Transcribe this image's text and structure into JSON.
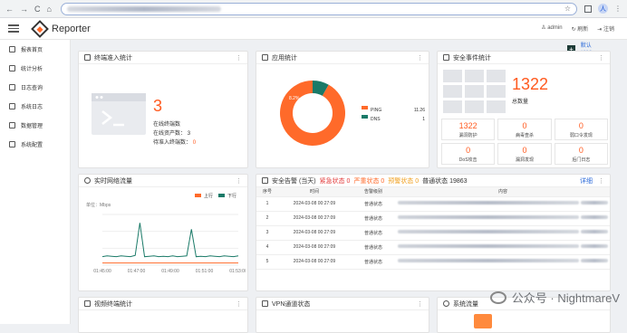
{
  "browser": {
    "back": "←",
    "forward": "→",
    "reload": "C",
    "home": "⌂",
    "star": "☆",
    "menu": "⋮",
    "user_initial": "人"
  },
  "app": {
    "title": "Reporter",
    "user": "admin",
    "refresh": "刷新",
    "logout": "注销",
    "add": "+",
    "default_layout": "默认排版"
  },
  "sidebar": {
    "items": [
      {
        "label": "报表首页",
        "icon": "home-icon"
      },
      {
        "label": "统计分析",
        "icon": "bar-chart-icon"
      },
      {
        "label": "日志查询",
        "icon": "log-icon"
      },
      {
        "label": "系统日志",
        "icon": "file-icon"
      },
      {
        "label": "数据管理",
        "icon": "database-icon"
      },
      {
        "label": "系统配置",
        "icon": "gear-icon"
      }
    ]
  },
  "terminal": {
    "title": "终端准入统计",
    "count": "3",
    "online_label": "在线终端数",
    "online_assets_label": "在线资产数：",
    "online_assets": "3",
    "pending_label": "待准入终端数：",
    "pending": "0"
  },
  "app_stats": {
    "title": "应用统计",
    "legend": [
      {
        "name": "PING",
        "color": "#ff6a2a",
        "value": "11.26"
      },
      {
        "name": "DNS",
        "color": "#1a7a68",
        "value": "1"
      }
    ],
    "chart_data": {
      "type": "pie",
      "slices": [
        {
          "name": "PING",
          "value": 91.8,
          "color": "#ff6a2a"
        },
        {
          "name": "DNS",
          "value": 8.2,
          "color": "#1a7a68"
        }
      ],
      "labels": [
        "8.2%",
        "91.8%"
      ]
    }
  },
  "security": {
    "title": "安全事件统计",
    "total": "1322",
    "total_label": "总数量",
    "cells": [
      {
        "value": "1322",
        "label": "漏洞防护"
      },
      {
        "value": "0",
        "label": "病毒查杀"
      },
      {
        "value": "0",
        "label": "弱口令发现"
      },
      {
        "value": "0",
        "label": "DoS攻击"
      },
      {
        "value": "0",
        "label": "漏洞发现"
      },
      {
        "value": "0",
        "label": "后门日志"
      }
    ]
  },
  "traffic": {
    "title": "实时网络流量",
    "unit": "单位：Mbps",
    "up": "上行",
    "down": "下行",
    "up_color": "#ff6a2a",
    "down_color": "#1a7a68",
    "chart_data": {
      "type": "line",
      "ylabel": "单位：Mbps",
      "x": [
        "01:45:00",
        "01:47:00",
        "01:49:00",
        "01:51:00",
        "01:53:00"
      ],
      "series": [
        {
          "name": "上行",
          "values": [
            0.05,
            0.05,
            0.05,
            0.05,
            0.05,
            0.05,
            0.05,
            0.05,
            0.05,
            0.05,
            0.05,
            0.05,
            0.05,
            0.05,
            0.05,
            0.05,
            0.05,
            0.05,
            0.05,
            0.05,
            0.05,
            0.05,
            0.05,
            0.05,
            0.05,
            0.05,
            0.05,
            0.05,
            0.05,
            0.05
          ]
        },
        {
          "name": "下行",
          "values": [
            0.2,
            0.22,
            0.21,
            0.2,
            0.22,
            0.21,
            0.2,
            0.23,
            1.0,
            0.2,
            0.21,
            0.22,
            0.2,
            0.21,
            0.2,
            0.22,
            0.2,
            0.21,
            0.22,
            0.85,
            0.2,
            0.21,
            0.2,
            0.22,
            0.21,
            0.2,
            0.22,
            0.21,
            0.2,
            0.22
          ]
        }
      ]
    }
  },
  "alarms": {
    "title": "安全告警 (当天)",
    "urgent": "紧急状态 0",
    "severe": "严重状态 0",
    "warning": "预警状态 0",
    "normal": "普通状态 19863",
    "detail": "详细",
    "headers": [
      "序号",
      "时间",
      "告警级别",
      "内容"
    ],
    "rows": [
      {
        "no": "1",
        "time": "2024-03-08 00:27:09",
        "level": "普通状态"
      },
      {
        "no": "2",
        "time": "2024-03-08 00:27:09",
        "level": "普通状态"
      },
      {
        "no": "3",
        "time": "2024-03-08 00:27:09",
        "level": "普通状态"
      },
      {
        "no": "4",
        "time": "2024-03-08 00:27:09",
        "level": "普通状态"
      },
      {
        "no": "5",
        "time": "2024-03-08 00:27:09",
        "level": "普通状态"
      }
    ]
  },
  "bottom": {
    "video": "视频终端统计",
    "vpn": "VPN通道状态",
    "third": "系统流量"
  },
  "watermark": "公众号 · NightmareV"
}
